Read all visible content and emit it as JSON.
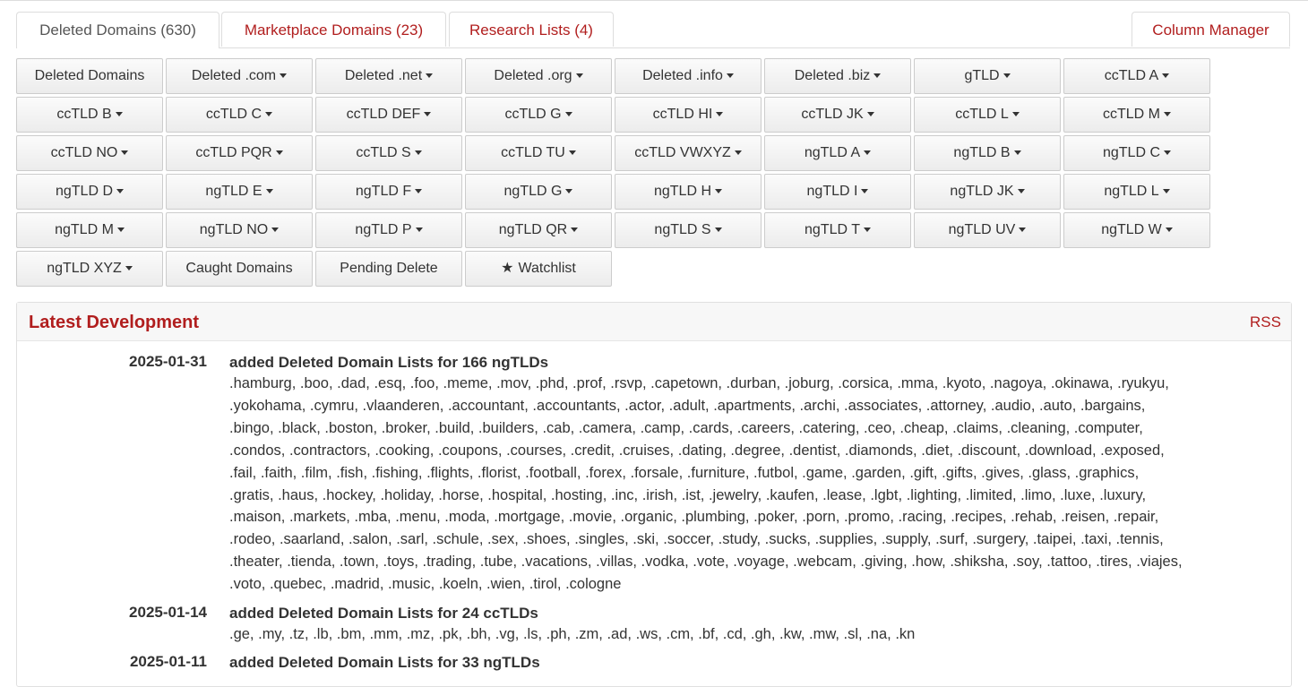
{
  "tabs": [
    {
      "label": "Deleted Domains (630)"
    },
    {
      "label": "Marketplace Domains (23)"
    },
    {
      "label": "Research Lists (4)"
    }
  ],
  "column_manager": "Column Manager",
  "buttons": [
    {
      "label": "Deleted Domains",
      "caret": false
    },
    {
      "label": "Deleted .com",
      "caret": true
    },
    {
      "label": "Deleted .net",
      "caret": true
    },
    {
      "label": "Deleted .org",
      "caret": true
    },
    {
      "label": "Deleted .info",
      "caret": true
    },
    {
      "label": "Deleted .biz",
      "caret": true
    },
    {
      "label": "gTLD",
      "caret": true
    },
    {
      "label": "ccTLD A",
      "caret": true
    },
    {
      "label": "ccTLD B",
      "caret": true
    },
    {
      "label": "ccTLD C",
      "caret": true
    },
    {
      "label": "ccTLD DEF",
      "caret": true
    },
    {
      "label": "ccTLD G",
      "caret": true
    },
    {
      "label": "ccTLD HI",
      "caret": true
    },
    {
      "label": "ccTLD JK",
      "caret": true
    },
    {
      "label": "ccTLD L",
      "caret": true
    },
    {
      "label": "ccTLD M",
      "caret": true
    },
    {
      "label": "ccTLD NO",
      "caret": true
    },
    {
      "label": "ccTLD PQR",
      "caret": true
    },
    {
      "label": "ccTLD S",
      "caret": true
    },
    {
      "label": "ccTLD TU",
      "caret": true
    },
    {
      "label": "ccTLD VWXYZ",
      "caret": true
    },
    {
      "label": "ngTLD A",
      "caret": true
    },
    {
      "label": "ngTLD B",
      "caret": true
    },
    {
      "label": "ngTLD C",
      "caret": true
    },
    {
      "label": "ngTLD D",
      "caret": true
    },
    {
      "label": "ngTLD E",
      "caret": true
    },
    {
      "label": "ngTLD F",
      "caret": true
    },
    {
      "label": "ngTLD G",
      "caret": true
    },
    {
      "label": "ngTLD H",
      "caret": true
    },
    {
      "label": "ngTLD I",
      "caret": true
    },
    {
      "label": "ngTLD JK",
      "caret": true
    },
    {
      "label": "ngTLD L",
      "caret": true
    },
    {
      "label": "ngTLD M",
      "caret": true
    },
    {
      "label": "ngTLD NO",
      "caret": true
    },
    {
      "label": "ngTLD P",
      "caret": true
    },
    {
      "label": "ngTLD QR",
      "caret": true
    },
    {
      "label": "ngTLD S",
      "caret": true
    },
    {
      "label": "ngTLD T",
      "caret": true
    },
    {
      "label": "ngTLD UV",
      "caret": true
    },
    {
      "label": "ngTLD W",
      "caret": true
    },
    {
      "label": "ngTLD XYZ",
      "caret": true
    },
    {
      "label": "Caught Domains",
      "caret": false
    },
    {
      "label": "Pending Delete",
      "caret": false
    },
    {
      "label": "Watchlist",
      "caret": false,
      "icon": "star-icon"
    }
  ],
  "latest": {
    "title": "Latest Development",
    "rss": "RSS",
    "entries": [
      {
        "date": "2025-01-31",
        "title": "added Deleted Domain Lists for 166 ngTLDs",
        "lines": [
          ".hamburg, .boo, .dad, .esq, .foo, .meme, .mov, .phd, .prof, .rsvp, .capetown, .durban, .joburg, .corsica, .mma, .kyoto, .nagoya, .okinawa, .ryukyu,",
          ".yokohama, .cymru, .vlaanderen, .accountant, .accountants, .actor, .adult, .apartments, .archi, .associates, .attorney, .audio, .auto, .bargains,",
          ".bingo, .black, .boston, .broker, .build, .builders, .cab, .camera, .camp, .cards, .careers, .catering, .ceo, .cheap, .claims, .cleaning, .computer,",
          ".condos, .contractors, .cooking, .coupons, .courses, .credit, .cruises, .dating, .degree, .dentist, .diamonds, .diet, .discount, .download, .exposed,",
          ".fail, .faith, .film, .fish, .fishing, .flights, .florist, .football, .forex, .forsale, .furniture, .futbol, .game, .garden, .gift, .gifts, .gives, .glass, .graphics,",
          ".gratis, .haus, .hockey, .holiday, .horse, .hospital, .hosting, .inc, .irish, .ist, .jewelry, .kaufen, .lease, .lgbt, .lighting, .limited, .limo, .luxe, .luxury,",
          ".maison, .markets, .mba, .menu, .moda, .mortgage, .movie, .organic, .plumbing, .poker, .porn, .promo, .racing, .recipes, .rehab, .reisen, .repair,",
          ".rodeo, .saarland, .salon, .sarl, .schule, .sex, .shoes, .singles, .ski, .soccer, .study, .sucks, .supplies, .supply, .surf, .surgery, .taipei, .taxi, .tennis,",
          ".theater, .tienda, .town, .toys, .trading, .tube, .vacations, .villas, .vodka, .vote, .voyage, .webcam, .giving, .how, .shiksha, .soy, .tattoo, .tires, .viajes,",
          ".voto, .quebec, .madrid, .music, .koeln, .wien, .tirol, .cologne"
        ]
      },
      {
        "date": "2025-01-14",
        "title": "added Deleted Domain Lists for 24 ccTLDs",
        "lines": [
          ".ge, .my, .tz, .lb, .bm, .mm, .mz, .pk, .bh, .vg, .ls, .ph, .zm, .ad, .ws, .cm, .bf, .cd, .gh, .kw, .mw, .sl, .na, .kn"
        ]
      },
      {
        "date": "2025-01-11",
        "title": "added Deleted Domain Lists for 33 ngTLDs",
        "lines": []
      }
    ]
  }
}
